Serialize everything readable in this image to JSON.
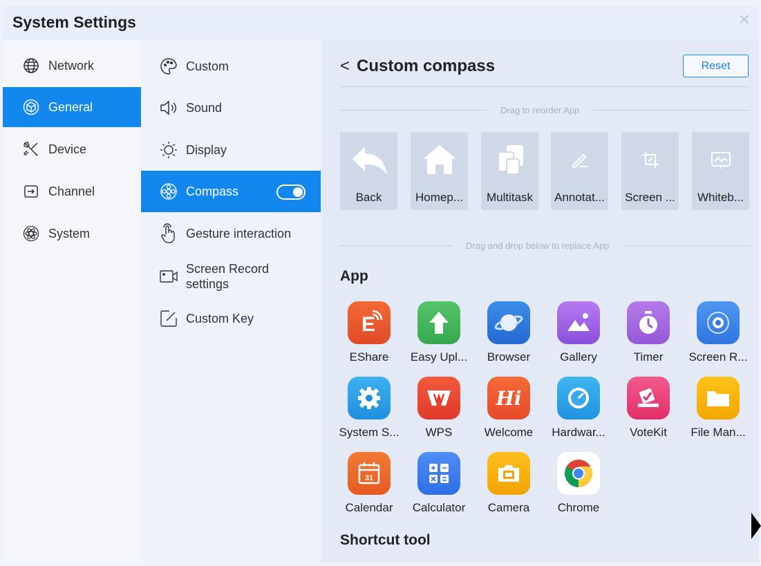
{
  "window": {
    "title": "System Settings"
  },
  "sidebar": {
    "items": [
      {
        "label": "Network",
        "icon": "globe-icon"
      },
      {
        "label": "General",
        "icon": "cube-icon"
      },
      {
        "label": "Device",
        "icon": "tools-icon"
      },
      {
        "label": "Channel",
        "icon": "input-icon"
      },
      {
        "label": "System",
        "icon": "atom-icon"
      }
    ]
  },
  "submenu": {
    "items": [
      {
        "label": "Custom",
        "icon": "palette-icon"
      },
      {
        "label": "Sound",
        "icon": "speaker-icon"
      },
      {
        "label": "Display",
        "icon": "brightness-icon"
      },
      {
        "label": "Compass",
        "icon": "compass-icon"
      },
      {
        "label": "Gesture interaction",
        "icon": "hand-pointer-icon"
      },
      {
        "label_line1": "Screen Record",
        "label_line2": "settings",
        "icon": "record-icon"
      },
      {
        "label": "Custom Key",
        "icon": "edit-key-icon"
      }
    ]
  },
  "main": {
    "back": "<",
    "title": "Custom compass",
    "reset": "Reset",
    "reorder_hint": "Drag to reorder App",
    "replace_hint": "Drag and drop below to replace App",
    "compass_slots": [
      {
        "label": "Back",
        "icon": "back-arrow-icon"
      },
      {
        "label": "Homep...",
        "icon": "home-icon"
      },
      {
        "label": "Multitask",
        "icon": "multitask-icon"
      },
      {
        "label": "Annotat...",
        "icon": "pencil-icon"
      },
      {
        "label": "Screen ...",
        "icon": "crop-icon"
      },
      {
        "label": "Whiteb...",
        "icon": "whiteboard-icon"
      }
    ],
    "app_section": "App",
    "apps": [
      {
        "label": "EShare",
        "icon": "eshare-icon",
        "color": "#e8532c"
      },
      {
        "label": "Easy Upl...",
        "icon": "upload-icon",
        "color": "#41b75a"
      },
      {
        "label": "Browser",
        "icon": "planet-icon",
        "color": "#2d7ce0"
      },
      {
        "label": "Gallery",
        "icon": "gallery-icon",
        "color": "#9b5de5"
      },
      {
        "label": "Timer",
        "icon": "timer-icon",
        "color": "#a865e0"
      },
      {
        "label": "Screen R...",
        "icon": "screen-record-icon",
        "color": "#3c86e8"
      },
      {
        "label": "System S...",
        "icon": "gear-icon",
        "color": "#2a9fe6"
      },
      {
        "label": "WPS",
        "icon": "wps-icon",
        "color": "#ef4a33"
      },
      {
        "label": "Welcome",
        "icon": "welcome-icon",
        "color": "#ef5a2f"
      },
      {
        "label": "Hardwar...",
        "icon": "hardware-icon",
        "color": "#2ea5e8"
      },
      {
        "label": "VoteKit",
        "icon": "votekit-icon",
        "color": "#ee3f78"
      },
      {
        "label": "File Man...",
        "icon": "folder-icon",
        "color": "#f5b300"
      },
      {
        "label": "Calendar",
        "icon": "calendar-icon",
        "color": "#ef6a2a"
      },
      {
        "label": "Calculator",
        "icon": "calculator-icon",
        "color": "#3d7cf0"
      },
      {
        "label": "Camera",
        "icon": "camera-icon",
        "color": "#f5b000"
      },
      {
        "label": "Chrome",
        "icon": "chrome-icon",
        "color": "#ffffff"
      }
    ],
    "shortcut_section": "Shortcut tool",
    "welcome_glyph": "Hi",
    "calendar_day": "31"
  }
}
